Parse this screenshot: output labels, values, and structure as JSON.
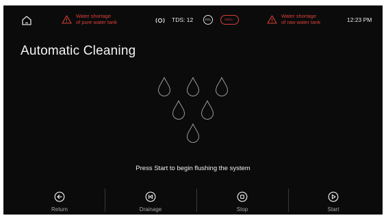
{
  "status_bar": {
    "warning_pure": "Water shortage\nof pure water tank",
    "warning_pure_line1": "Water shortage",
    "warning_pure_line2": "of pure water tank",
    "tds": "TDS: 12",
    "co2_badge": "CO₂",
    "hco3_badge": "HCO₃⁻",
    "warning_raw_line1": "Water shortage",
    "warning_raw_line2": "of raw water tank",
    "time": "12:23 PM"
  },
  "page": {
    "title": "Automatic Cleaning",
    "message": "Press Start to begin flushing the system"
  },
  "actions": {
    "return_label": "Return",
    "drainage_label": "Drainage",
    "stop_label": "Stop",
    "start_label": "Start"
  },
  "icons": {
    "home": "home-icon",
    "warning": "warning-triangle-icon",
    "sensor": "sensor-icon",
    "drop": "water-drop-icon",
    "return": "arrow-left-circle-icon",
    "drainage": "skip-back-circle-icon",
    "stop": "stop-circle-icon",
    "start": "play-circle-icon"
  },
  "colors": {
    "background": "#0b0b0b",
    "text": "#f2f2f2",
    "warning": "#d9413a",
    "muted": "#a8a8a8",
    "divider": "#3a3a3a"
  }
}
